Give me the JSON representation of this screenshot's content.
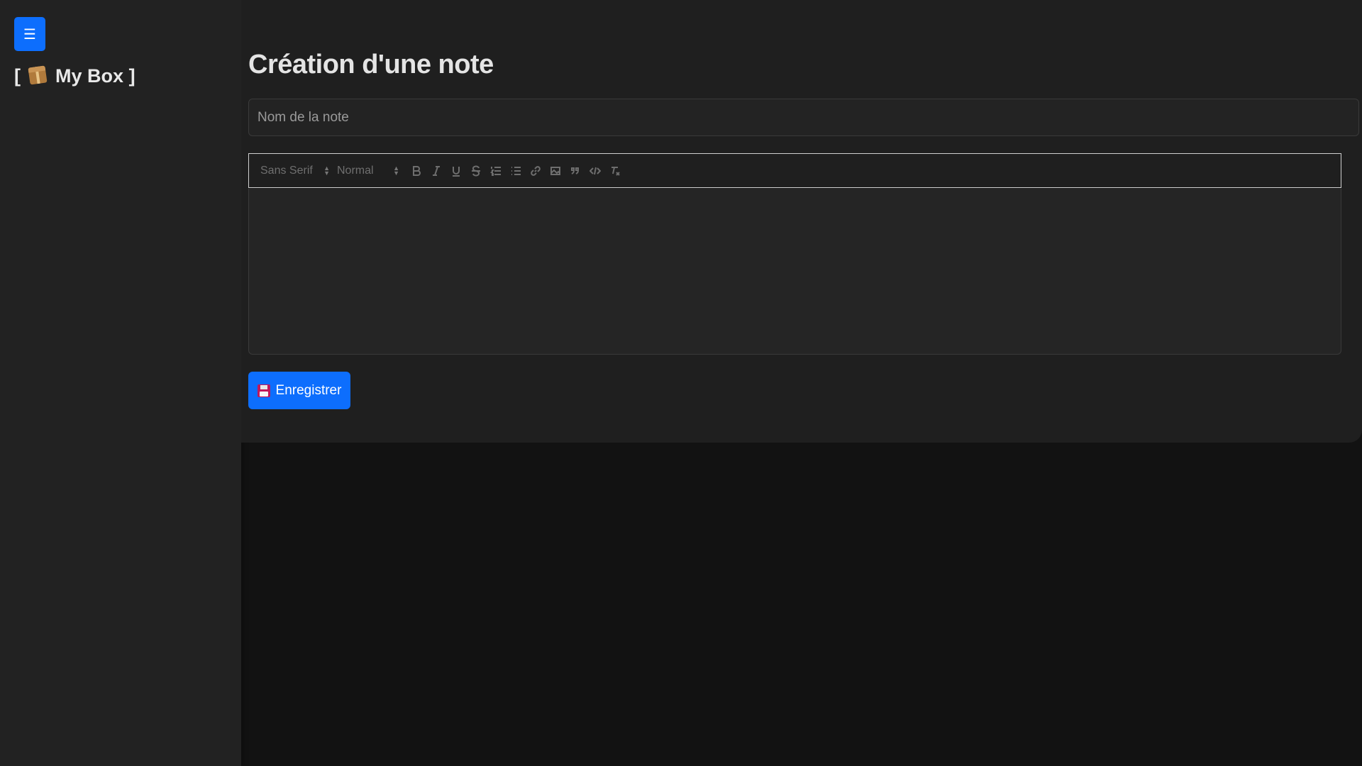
{
  "sidebar": {
    "menu_toggle_label": "☰",
    "brand_prefix": "[",
    "brand_name": "My Box",
    "brand_suffix": "]",
    "brand_icon": "package-icon"
  },
  "main": {
    "title": "Création d'une note",
    "note_name_placeholder": "Nom de la note",
    "note_name_value": "",
    "toolbar": {
      "font_select": "Sans Serif",
      "size_select": "Normal",
      "buttons": [
        "bold",
        "italic",
        "underline",
        "strike",
        "ordered-list",
        "bullet-list",
        "link",
        "image",
        "blockquote",
        "code",
        "clean"
      ]
    },
    "editor_content": "",
    "save_label": "Enregistrer",
    "save_icon": "floppy-disk-icon"
  },
  "colors": {
    "accent": "#0d6efd",
    "sidebar_bg": "#222222",
    "card_bg": "#1f1f1f",
    "page_bg": "#121212"
  }
}
